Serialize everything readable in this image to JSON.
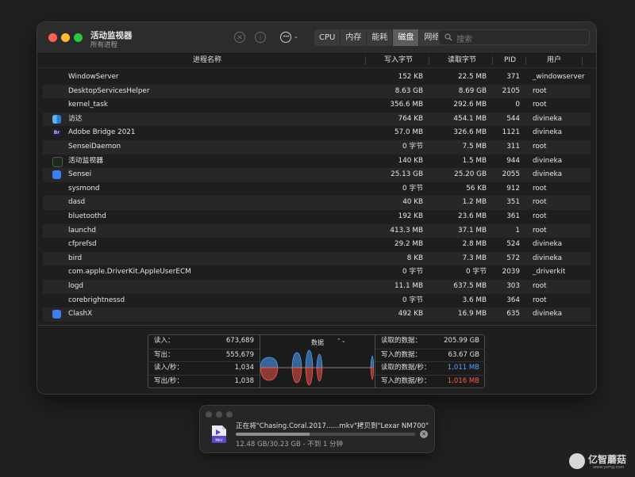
{
  "window": {
    "title": "活动监视器",
    "subtitle": "所有进程"
  },
  "toolbar": {
    "stop_icon": "✕",
    "info_icon": "i",
    "more_chevron": "⌄"
  },
  "tabs": [
    {
      "label": "CPU"
    },
    {
      "label": "内存"
    },
    {
      "label": "能耗"
    },
    {
      "label": "磁盘",
      "active": true
    },
    {
      "label": "网络"
    }
  ],
  "search": {
    "placeholder": "搜索"
  },
  "columns": {
    "name": "进程名称",
    "bytes_written": "写入字节",
    "bytes_read": "读取字节",
    "pid": "PID",
    "user": "用户"
  },
  "processes": [
    {
      "name": "WindowServer",
      "written": "152 KB",
      "read": "22.5 MB",
      "pid": "371",
      "user": "_windowserver",
      "icon": ""
    },
    {
      "name": "DesktopServicesHelper",
      "written": "8.63 GB",
      "read": "8.69 GB",
      "pid": "2105",
      "user": "root",
      "icon": ""
    },
    {
      "name": "kernel_task",
      "written": "356.6 MB",
      "read": "292.6 MB",
      "pid": "0",
      "user": "root",
      "icon": ""
    },
    {
      "name": "访达",
      "written": "764 KB",
      "read": "454.1 MB",
      "pid": "544",
      "user": "divineka",
      "icon": "finder-icon"
    },
    {
      "name": "Adobe Bridge 2021",
      "written": "57.0 MB",
      "read": "326.6 MB",
      "pid": "1121",
      "user": "divineka",
      "icon": "adobe-bridge-icon",
      "icon_text": "Br"
    },
    {
      "name": "SenseiDaemon",
      "written": "0 字节",
      "read": "7.5 MB",
      "pid": "311",
      "user": "root",
      "icon": ""
    },
    {
      "name": "活动监视器",
      "written": "140 KB",
      "read": "1.5 MB",
      "pid": "944",
      "user": "divineka",
      "icon": "activity-monitor-icon"
    },
    {
      "name": "Sensei",
      "written": "25.13 GB",
      "read": "25.20 GB",
      "pid": "2055",
      "user": "divineka",
      "icon": "sensei-icon"
    },
    {
      "name": "sysmond",
      "written": "0 字节",
      "read": "56 KB",
      "pid": "912",
      "user": "root",
      "icon": ""
    },
    {
      "name": "dasd",
      "written": "40 KB",
      "read": "1.2 MB",
      "pid": "351",
      "user": "root",
      "icon": ""
    },
    {
      "name": "bluetoothd",
      "written": "192 KB",
      "read": "23.6 MB",
      "pid": "361",
      "user": "root",
      "icon": ""
    },
    {
      "name": "launchd",
      "written": "413.3 MB",
      "read": "37.1 MB",
      "pid": "1",
      "user": "root",
      "icon": ""
    },
    {
      "name": "cfprefsd",
      "written": "29.2 MB",
      "read": "2.8 MB",
      "pid": "524",
      "user": "divineka",
      "icon": ""
    },
    {
      "name": "bird",
      "written": "8 KB",
      "read": "7.3 MB",
      "pid": "572",
      "user": "divineka",
      "icon": ""
    },
    {
      "name": "com.apple.DriverKit.AppleUserECM",
      "written": "0 字节",
      "read": "0 字节",
      "pid": "2039",
      "user": "_driverkit",
      "icon": ""
    },
    {
      "name": "logd",
      "written": "11.1 MB",
      "read": "637.5 MB",
      "pid": "303",
      "user": "root",
      "icon": ""
    },
    {
      "name": "corebrightnessd",
      "written": "0 字节",
      "read": "3.6 MB",
      "pid": "364",
      "user": "root",
      "icon": ""
    },
    {
      "name": "ClashX",
      "written": "492 KB",
      "read": "16.9 MB",
      "pid": "635",
      "user": "divineka",
      "icon": "clashx-icon"
    }
  ],
  "stats": {
    "left": [
      {
        "label": "读入：",
        "value": "673,689"
      },
      {
        "label": "写出：",
        "value": "555,679"
      },
      {
        "label": "读入/秒：",
        "value": "1,034"
      },
      {
        "label": "写出/秒：",
        "value": "1,038"
      }
    ],
    "graph_label": "数据",
    "graph_chevron": "⌃⌄",
    "right": [
      {
        "label": "读取的数据：",
        "value": "205.99 GB",
        "tone": ""
      },
      {
        "label": "写入的数据：",
        "value": "63.67 GB",
        "tone": ""
      },
      {
        "label": "读取的数据/秒：",
        "value": "1,011 MB",
        "tone": "blue"
      },
      {
        "label": "写入的数据/秒：",
        "value": "1,016 MB",
        "tone": "red"
      }
    ],
    "colors": {
      "read": "#4fa3ff",
      "write": "#ff5a4e"
    }
  },
  "notification": {
    "title": "正在将\"Chasing.Coral.2017......mkv\"拷贝到\"Lexar NM700\"",
    "progress": 0.41,
    "subtitle": "12.48 GB/30.23 GB - 不到 1 分钟",
    "file_icon_label": "MKV"
  },
  "watermark": {
    "text": "亿智蘑菇",
    "url": "www.yzmg.com"
  }
}
